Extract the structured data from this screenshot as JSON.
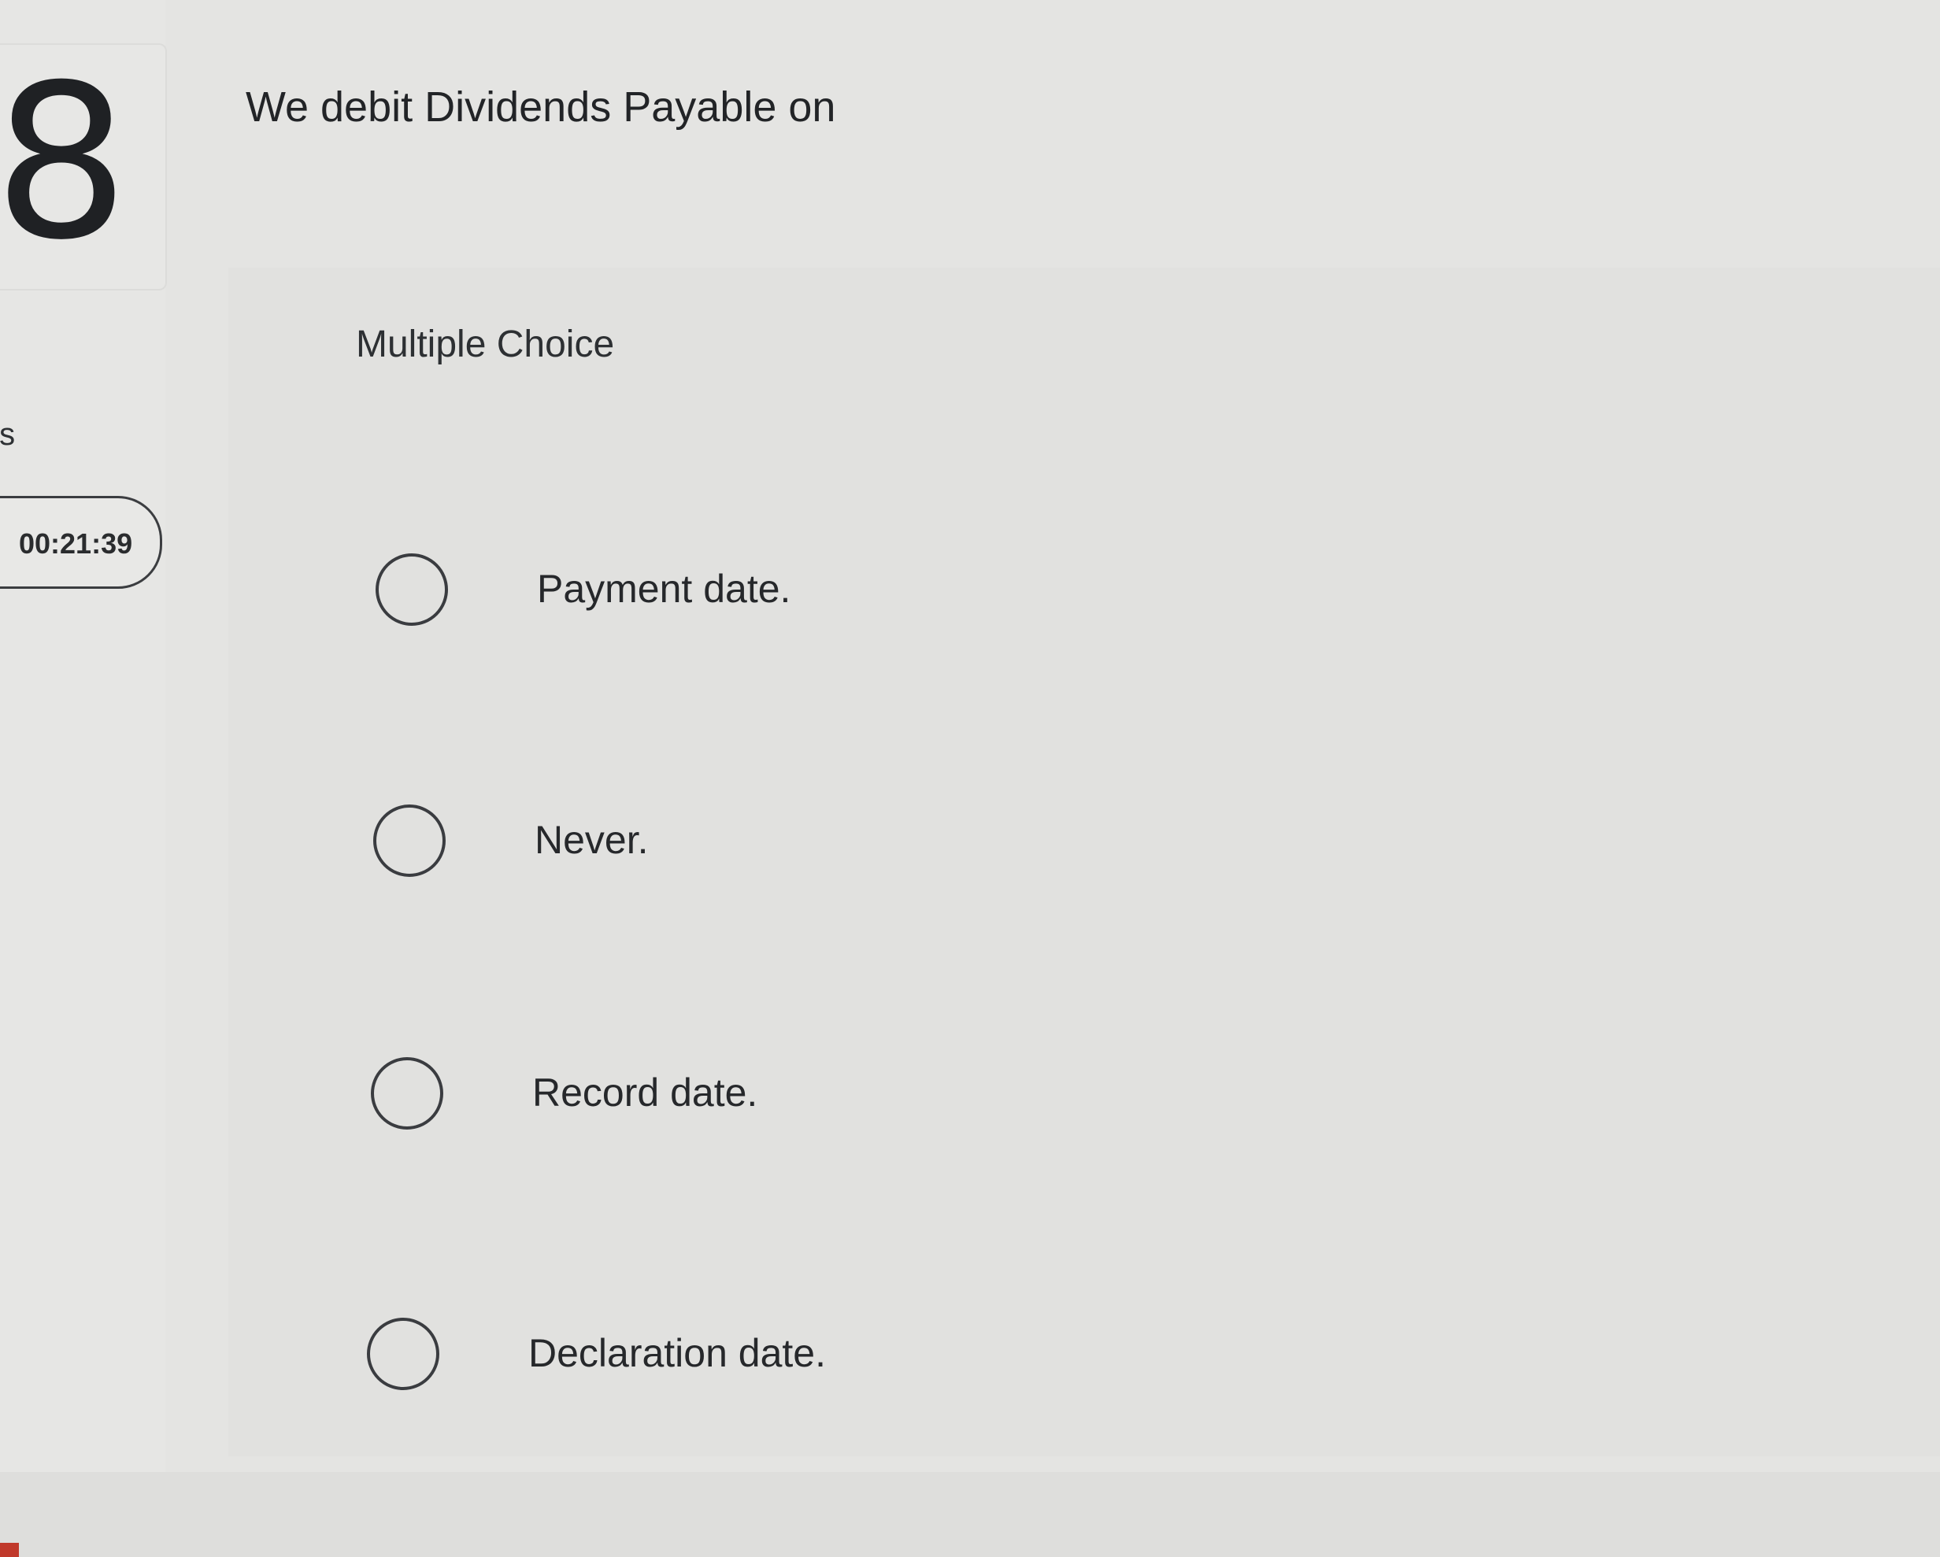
{
  "question": {
    "number": "8",
    "prompt": "We debit Dividends Payable on",
    "type_label": "Multiple Choice"
  },
  "sidebar": {
    "points_label": "ts",
    "timer": "00:21:39"
  },
  "options": [
    {
      "label": "Payment date."
    },
    {
      "label": "Never."
    },
    {
      "label": "Record date."
    },
    {
      "label": "Declaration date."
    }
  ]
}
